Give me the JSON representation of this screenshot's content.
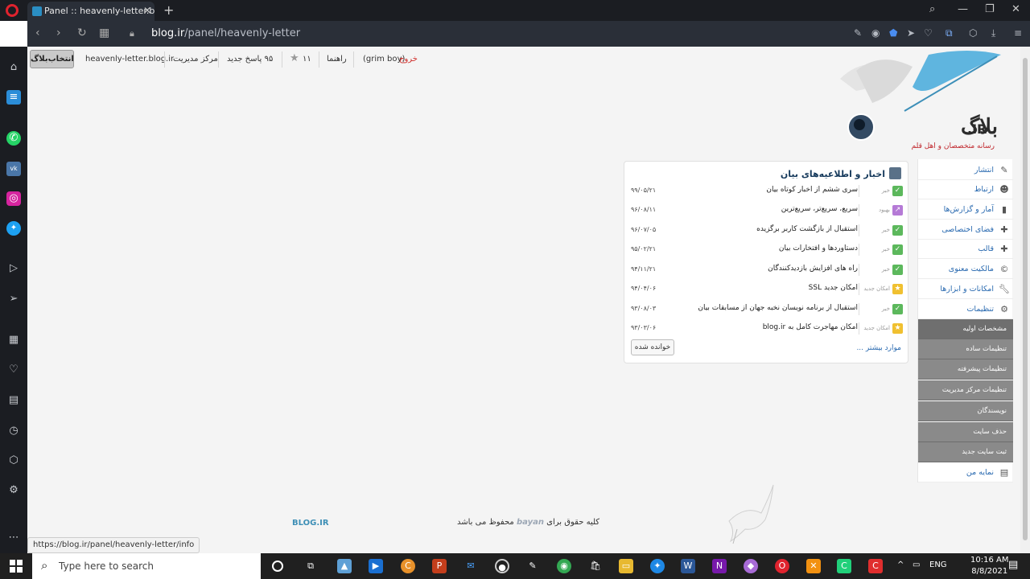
{
  "browser": {
    "tab_title": "Panel :: heavenly-letter.blog.ir",
    "url_host": "blog.ir",
    "url_path": "/panel/heavenly-letter",
    "status_url": "https://blog.ir/panel/heavenly-letter/info"
  },
  "topbar": {
    "select_blog": "انتخاب‌بلاگ",
    "blog_domain": "heavenly-letter.blog.ir",
    "admin_center": "مرکز مدیریت",
    "new_replies": "۹۵ پاسخ جدید",
    "stars": "۱۱",
    "help": "راهنما",
    "user": "(grim boy)",
    "logout": "خروج"
  },
  "logo": {
    "text": "بلاگ.IR",
    "tagline": "رسانه متخصصان و اهل قلم"
  },
  "news": {
    "title": "اخبار و اطلاعیه‌های بیان",
    "items": [
      {
        "tag": "خبر",
        "title": "سری ششم از اخبار کوتاه بیان",
        "date": "۹۹/۰۵/۲۱",
        "kind": "news"
      },
      {
        "tag": "بهبود",
        "title": "سریع، سریع‌تر، سریع‌ترین",
        "date": "۹۶/۰۸/۱۱",
        "kind": "improve"
      },
      {
        "tag": "خبر",
        "title": "استقبال از بازگشت کاربر برگزیده",
        "date": "۹۶/۰۷/۰۵",
        "kind": "news"
      },
      {
        "tag": "خبر",
        "title": "دستاوردها و افتخارات بیان",
        "date": "۹۵/۰۲/۲۱",
        "kind": "news"
      },
      {
        "tag": "خبر",
        "title": "راه های افزایش بازدیدکنندگان",
        "date": "۹۴/۱۱/۲۱",
        "kind": "news"
      },
      {
        "tag": "امکان جدید",
        "title": "امکان جدید SSL",
        "date": "۹۴/۰۴/۰۶",
        "kind": "feature"
      },
      {
        "tag": "خبر",
        "title": "استقبال از برنامه نویسان نخبه جهان از مسابقات بیان",
        "date": "۹۳/۰۸/۰۳",
        "kind": "news"
      },
      {
        "tag": "امکان جدید",
        "title": "امکان مهاجرت کامل به blog.ir",
        "date": "۹۳/۰۳/۰۶",
        "kind": "feature"
      }
    ],
    "read_button": "خوانده شده",
    "more_link": "موارد بیشتر ..."
  },
  "menu": {
    "items": [
      {
        "label": "انتشار",
        "icon": "publish-icon"
      },
      {
        "label": "ارتباط",
        "icon": "contact-icon"
      },
      {
        "label": "آمار و گزارش‌ها",
        "icon": "stats-icon"
      },
      {
        "label": "فضای اختصاصی",
        "icon": "puzzle-icon"
      },
      {
        "label": "قالب",
        "icon": "template-icon"
      },
      {
        "label": "مالکیت معنوی",
        "icon": "copyright-icon"
      },
      {
        "label": "امکانات و ابزارها",
        "icon": "wrench-icon"
      },
      {
        "label": "تنظیمات",
        "icon": "gear-icon"
      }
    ],
    "subitems": [
      "مشخصات اولیه",
      "تنظیمات ساده",
      "تنظیمات پیشرفته",
      "تنظیمات مرکز مدیریت",
      "نویسندگان",
      "حذف سایت",
      "ثبت سایت جدید"
    ],
    "last_item": "نمایه من"
  },
  "footer": {
    "blog_logo": "BLOG.IR",
    "copy_prefix": "کلیه حقوق برای",
    "bayan": "bayan",
    "copy_suffix": "محفوظ می باشد"
  },
  "taskbar": {
    "search_placeholder": "Type here to search",
    "lang": "ENG",
    "time": "10:16 AM",
    "date": "8/8/2021"
  },
  "colors": {
    "accent_link": "#2a6ab0",
    "check_green": "#5cb85c",
    "improve_purple": "#b57ad6",
    "feature_yellow": "#f0c030"
  }
}
